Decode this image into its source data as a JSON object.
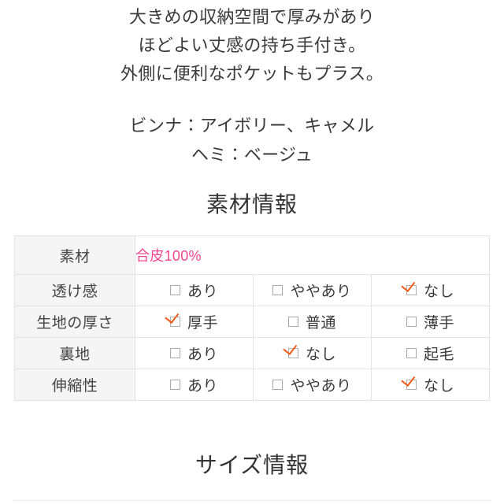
{
  "description": {
    "lines": [
      "大きめの収納空間で厚みがあり",
      "ほどよい丈感の持ち手付き。",
      "外側に便利なポケットもプラス。"
    ]
  },
  "colors_note": {
    "lines": [
      "ビンナ：アイボリー、キャメル",
      "ヘミ：ベージュ"
    ]
  },
  "material_section": {
    "heading": "素材情報",
    "accent_color": "#f4458e",
    "check_color": "#ef5a14",
    "label_bg": "#f5f5f5",
    "border_color": "#e3e3e3",
    "material_row": {
      "label": "素材",
      "value": "合皮100%"
    },
    "rows": [
      {
        "label": "透け感",
        "options": [
          {
            "label": "あり",
            "checked": false
          },
          {
            "label": "ややあり",
            "checked": false
          },
          {
            "label": "なし",
            "checked": true
          }
        ]
      },
      {
        "label": "生地の厚さ",
        "options": [
          {
            "label": "厚手",
            "checked": true
          },
          {
            "label": "普通",
            "checked": false
          },
          {
            "label": "薄手",
            "checked": false
          }
        ]
      },
      {
        "label": "裏地",
        "options": [
          {
            "label": "あり",
            "checked": false
          },
          {
            "label": "なし",
            "checked": true
          },
          {
            "label": "起毛",
            "checked": false
          }
        ]
      },
      {
        "label": "伸縮性",
        "options": [
          {
            "label": "あり",
            "checked": false
          },
          {
            "label": "ややあり",
            "checked": false
          },
          {
            "label": "なし",
            "checked": true
          }
        ]
      }
    ]
  },
  "size_section": {
    "heading": "サイズ情報"
  }
}
